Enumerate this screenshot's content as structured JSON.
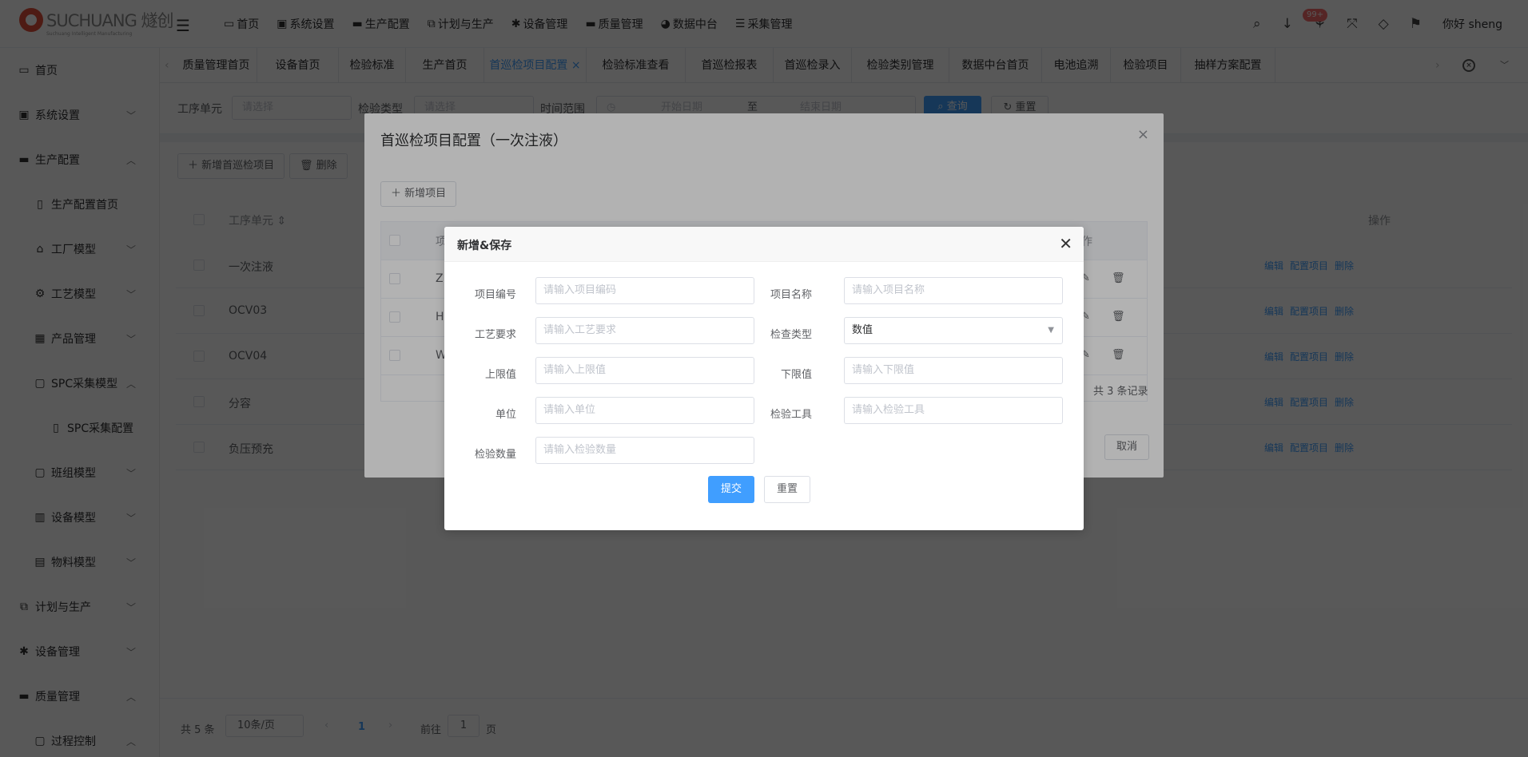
{
  "header": {
    "brand": "SUCHUANG 燧创",
    "brand_sub": "Suchuang Intelligent Manufacturing",
    "nav": [
      {
        "icon": "monitor-icon",
        "label": "首页"
      },
      {
        "icon": "lock-icon",
        "label": "系统设置"
      },
      {
        "icon": "briefcase-icon",
        "label": "生产配置"
      },
      {
        "icon": "plan-icon",
        "label": "计划与生产"
      },
      {
        "icon": "gear-icon",
        "label": "设备管理"
      },
      {
        "icon": "briefcase-icon",
        "label": "质量管理"
      },
      {
        "icon": "pie-icon",
        "label": "数据中台"
      },
      {
        "icon": "database-icon",
        "label": "采集管理"
      }
    ],
    "badge": "99+",
    "greeting": "你好 sheng"
  },
  "sidebar": {
    "items": [
      {
        "label": "首页",
        "icon": "monitor-icon",
        "arrow": ""
      },
      {
        "label": "系统设置",
        "icon": "lock-icon",
        "arrow": "﹀"
      },
      {
        "label": "生产配置",
        "icon": "briefcase-icon",
        "arrow": "︿"
      },
      {
        "label": "生产配置首页",
        "icon": "document-icon",
        "arrow": ""
      },
      {
        "label": "工厂模型",
        "icon": "bank-icon",
        "arrow": "﹀"
      },
      {
        "label": "工艺模型",
        "icon": "cog-icon",
        "arrow": "﹀"
      },
      {
        "label": "产品管理",
        "icon": "grid-icon",
        "arrow": "﹀"
      },
      {
        "label": "SPC采集模型",
        "icon": "folder-icon",
        "arrow": "︿"
      },
      {
        "label": "SPC采集配置",
        "icon": "document-icon",
        "arrow": ""
      },
      {
        "label": "班组模型",
        "icon": "folder-icon",
        "arrow": "﹀"
      },
      {
        "label": "设备模型",
        "icon": "barcode-icon",
        "arrow": "﹀"
      },
      {
        "label": "物料模型",
        "icon": "box-icon",
        "arrow": "﹀"
      },
      {
        "label": "计划与生产",
        "icon": "plan-icon",
        "arrow": "﹀"
      },
      {
        "label": "设备管理",
        "icon": "gear-icon",
        "arrow": "﹀"
      },
      {
        "label": "质量管理",
        "icon": "briefcase-icon",
        "arrow": "︿"
      },
      {
        "label": "过程控制",
        "icon": "folder-icon",
        "arrow": "︿"
      }
    ]
  },
  "tabs": [
    {
      "label": "质量管理首页"
    },
    {
      "label": "设备首页"
    },
    {
      "label": "检验标准"
    },
    {
      "label": "生产首页"
    },
    {
      "label": "首巡检项目配置",
      "active": true
    },
    {
      "label": "检验标准查看"
    },
    {
      "label": "首巡检报表"
    },
    {
      "label": "首巡检录入"
    },
    {
      "label": "检验类别管理"
    },
    {
      "label": "数据中台首页"
    },
    {
      "label": "电池追溯"
    },
    {
      "label": "检验项目"
    },
    {
      "label": "抽样方案配置"
    }
  ],
  "filter": {
    "unit_label": "工序单元",
    "unit_placeholder": "请选择",
    "type_label": "检验类型",
    "type_placeholder": "请选择",
    "range_label": "时间范围",
    "start_placeholder": "开始日期",
    "to": "至",
    "end_placeholder": "结束日期",
    "query": "查询",
    "reset": "重置"
  },
  "list": {
    "add_button": "新增首巡检项目",
    "delete_button": "删除",
    "col_unit": "工序单元",
    "col_ops": "操作",
    "rows": [
      {
        "unit": "一次注液"
      },
      {
        "unit": "OCV03"
      },
      {
        "unit": "OCV04"
      },
      {
        "unit": "分容"
      },
      {
        "unit": "负压预充"
      }
    ],
    "op_edit": "编辑",
    "op_config": "配置项目",
    "op_delete": "删除"
  },
  "pager": {
    "total": "共 5 条",
    "size": "10条/页",
    "page": "1",
    "goto": "前往",
    "goto_value": "1",
    "page_unit": "页"
  },
  "dialog_outer": {
    "title": "首巡检项目配置（一次注液）",
    "add_item": "新增项目",
    "col_first": "项",
    "col_ops": "作",
    "rows": [
      {
        "code": "Z"
      },
      {
        "code": "H"
      },
      {
        "code": "W"
      }
    ],
    "total": "共 3 条记录",
    "cancel": "取消"
  },
  "dialog_form": {
    "title": "新增&保存",
    "fields": {
      "code": {
        "label": "项目编号",
        "placeholder": "请输入项目编码"
      },
      "name": {
        "label": "项目名称",
        "placeholder": "请输入项目名称"
      },
      "process": {
        "label": "工艺要求",
        "placeholder": "请输入工艺要求"
      },
      "check_type": {
        "label": "检查类型",
        "value": "数值"
      },
      "upper": {
        "label": "上限值",
        "placeholder": "请输入上限值"
      },
      "lower": {
        "label": "下限值",
        "placeholder": "请输入下限值"
      },
      "unit": {
        "label": "单位",
        "placeholder": "请输入单位"
      },
      "tool": {
        "label": "检验工具",
        "placeholder": "请输入检验工具"
      },
      "qty": {
        "label": "检验数量",
        "placeholder": "请输入检验数量"
      }
    },
    "submit": "提交",
    "reset": "重置"
  }
}
